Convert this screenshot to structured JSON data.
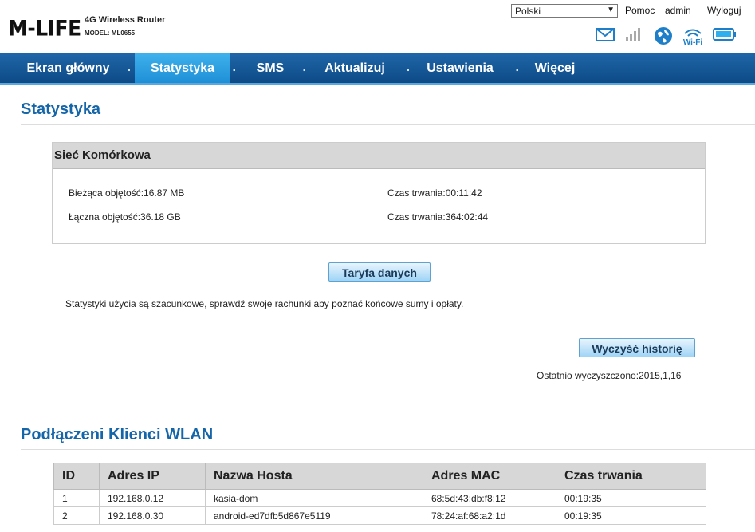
{
  "brand": {
    "logo": "M-LIFE",
    "product": "4G Wireless Router",
    "model": "MODEL: ML0655"
  },
  "header": {
    "language": "Polski",
    "links": {
      "help": "Pomoc",
      "user": "admin",
      "logout": "Wyloguj"
    },
    "icons": [
      "envelope-icon",
      "signal-icon",
      "globe-icon",
      "wifi-icon",
      "battery-icon"
    ]
  },
  "nav": {
    "items": [
      {
        "label": "Ekran główny"
      },
      {
        "label": "Statystyka"
      },
      {
        "label": "SMS"
      },
      {
        "label": "Aktualizuj"
      },
      {
        "label": "Ustawienia"
      },
      {
        "label": "Więcej"
      }
    ],
    "active": "Statystyka"
  },
  "stats": {
    "title": "Statystyka",
    "panel_title": "Sieć Komórkowa",
    "current_volume": "Bieżąca objętość:16.87 MB",
    "current_duration": "Czas trwania:00:11:42",
    "total_volume": "Łączna objętość:36.18 GB",
    "total_duration": "Czas trwania:364:02:44",
    "tariff_button": "Taryfa danych",
    "note": "Statystyki użycia są szacunkowe, sprawdź swoje rachunki aby poznać końcowe sumy i opłaty.",
    "clear_button": "Wyczyść historię",
    "last_cleared": "Ostatnio wyczyszczono:2015,1,16"
  },
  "wlan": {
    "title": "Podłączeni Klienci WLAN",
    "columns": [
      "ID",
      "Adres IP",
      "Nazwa Hosta",
      "Adres MAC",
      "Czas trwania"
    ],
    "rows": [
      [
        "1",
        "192.168.0.12",
        "kasia-dom",
        "68:5d:43:db:f8:12",
        "00:19:35"
      ],
      [
        "2",
        "192.168.0.30",
        "android-ed7dfb5d867e5119",
        "78:24:af:68:a2:1d",
        "00:19:35"
      ]
    ]
  },
  "colors": {
    "accent": "#1565a9",
    "nav_bg": "#0d4a86",
    "nav_active": "#2fa3e6"
  }
}
